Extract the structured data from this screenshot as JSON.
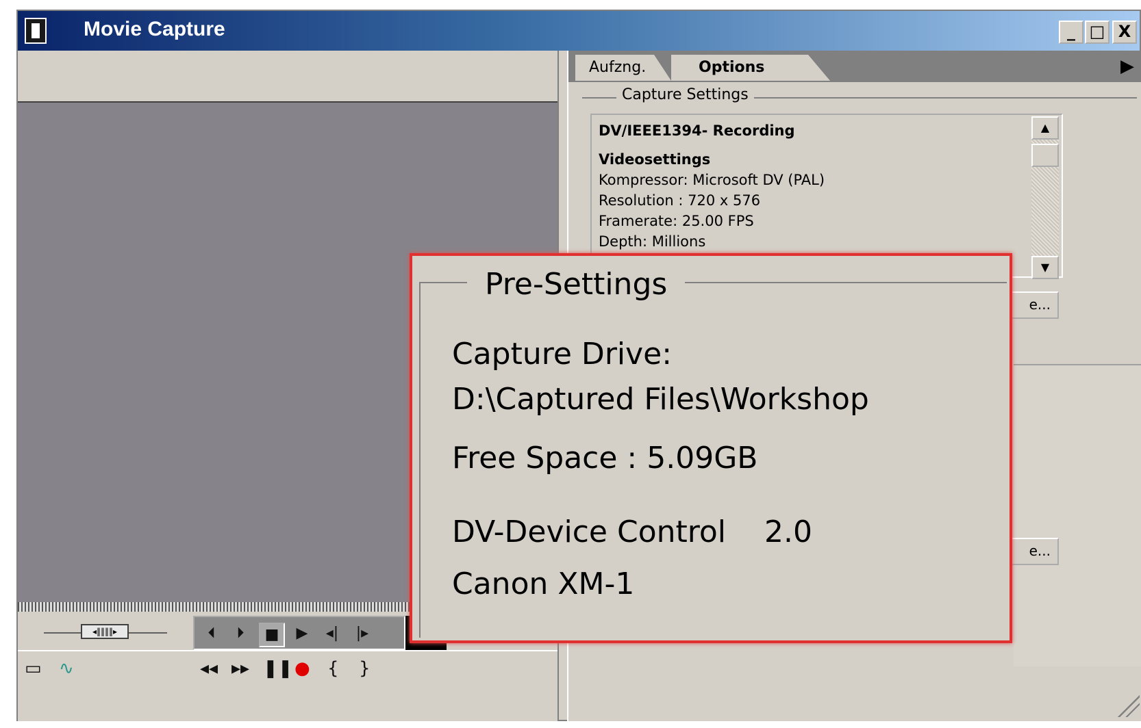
{
  "window": {
    "title": "Movie Capture",
    "minimize": "_",
    "maximize": "□",
    "close": "X"
  },
  "tabs": [
    {
      "label": "Aufzng.",
      "active": false
    },
    {
      "label": "Options",
      "active": true
    }
  ],
  "capture_settings": {
    "group_label": "Capture Settings",
    "heading": "DV/IEEE1394- Recording",
    "video_heading": "Videosettings",
    "lines": [
      "Kompressor: Microsoft DV (PAL)",
      "Resolution  : 720 x 576",
      "Framerate:  25.00 FPS",
      "Depth: Millions"
    ],
    "edit_button_1": "e...",
    "edit_button_2": "e..."
  },
  "transport": {
    "jog_label": "◂‖‖‖‖▸",
    "buttons": [
      "⏴",
      "⏵",
      "■",
      "▶",
      "◂|",
      "|▸"
    ],
    "lower_buttons": [
      "◂◂",
      "▸▸",
      "❚❚",
      "●",
      "{",
      "}"
    ]
  },
  "overlay": {
    "legend": "Pre-Settings",
    "capture_drive_label": "Capture Drive:",
    "capture_drive_path": "D:\\Captured Files\\Workshop",
    "free_space": "Free Space : 5.09GB",
    "device_control": "DV-Device Control    2.0",
    "camera": "Canon XM-1"
  },
  "colors": {
    "accent_red": "#e03030",
    "record": "#e00000",
    "titlebar_start": "#0a246a",
    "titlebar_end": "#a6caf0"
  }
}
